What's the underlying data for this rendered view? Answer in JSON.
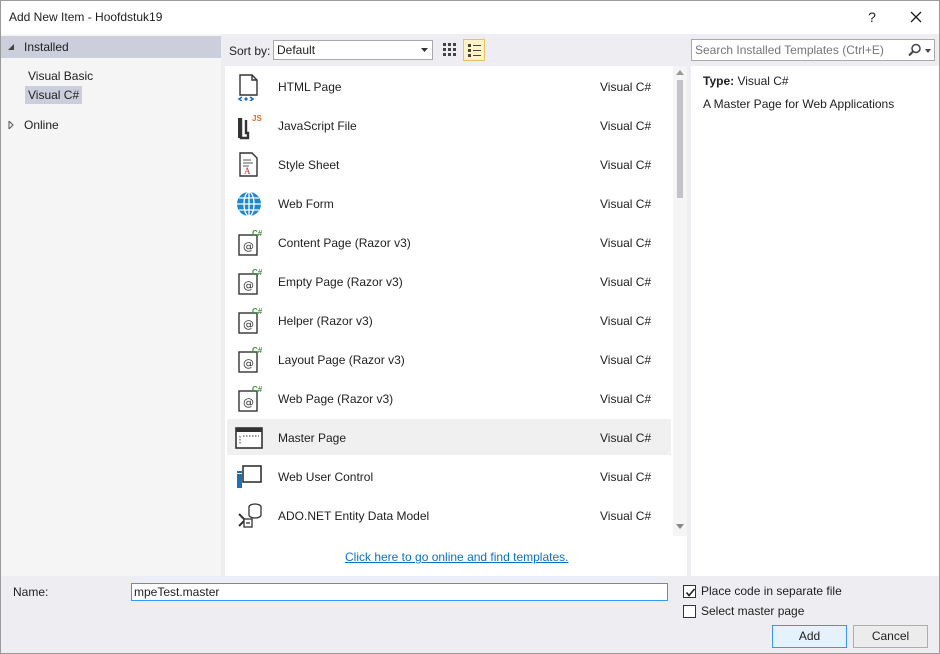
{
  "window": {
    "title": "Add New Item - Hoofdstuk19",
    "help_label": "?"
  },
  "tree": {
    "installed": "Installed",
    "children": [
      "Visual Basic",
      "Visual C#"
    ],
    "online": "Online"
  },
  "toolbar": {
    "sort_label": "Sort by:",
    "sort_value": "Default"
  },
  "search": {
    "placeholder": "Search Installed Templates (Ctrl+E)"
  },
  "templates": [
    {
      "name": "HTML Page",
      "lang": "Visual C#",
      "icon": "html-page-icon"
    },
    {
      "name": "JavaScript File",
      "lang": "Visual C#",
      "icon": "javascript-file-icon"
    },
    {
      "name": "Style Sheet",
      "lang": "Visual C#",
      "icon": "style-sheet-icon"
    },
    {
      "name": "Web Form",
      "lang": "Visual C#",
      "icon": "globe-icon"
    },
    {
      "name": "Content Page (Razor v3)",
      "lang": "Visual C#",
      "icon": "razor-page-icon"
    },
    {
      "name": "Empty Page (Razor v3)",
      "lang": "Visual C#",
      "icon": "razor-page-icon"
    },
    {
      "name": "Helper (Razor v3)",
      "lang": "Visual C#",
      "icon": "razor-page-icon"
    },
    {
      "name": "Layout Page (Razor v3)",
      "lang": "Visual C#",
      "icon": "razor-page-icon"
    },
    {
      "name": "Web Page (Razor v3)",
      "lang": "Visual C#",
      "icon": "razor-page-icon"
    },
    {
      "name": "Master Page",
      "lang": "Visual C#",
      "icon": "master-page-icon"
    },
    {
      "name": "Web User Control",
      "lang": "Visual C#",
      "icon": "user-control-icon"
    },
    {
      "name": "ADO.NET Entity Data Model",
      "lang": "Visual C#",
      "icon": "entity-model-icon"
    }
  ],
  "online_link": "Click here to go online and find templates.",
  "details": {
    "type_key": "Type:",
    "type_value": "Visual C#",
    "description": "A Master Page for Web Applications"
  },
  "bottom": {
    "name_label": "Name:",
    "name_value": "mpeTest.master",
    "place_code_label": "Place code in separate file",
    "place_code_checked": true,
    "select_master_label": "Select master page",
    "select_master_checked": false,
    "add_label": "Add",
    "cancel_label": "Cancel"
  },
  "colors": {
    "accent": "#3399ff",
    "selected_tree": "#cccedb",
    "link": "#0e70c0"
  }
}
